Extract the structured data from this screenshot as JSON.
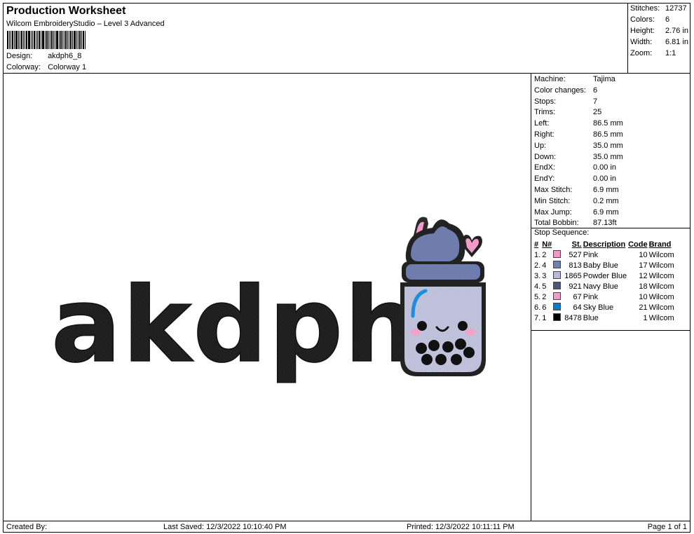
{
  "header": {
    "title": "Production Worksheet",
    "subtitle": "Wilcom EmbroideryStudio – Level 3 Advanced",
    "design_label": "Design:",
    "design_value": "akdph6_8",
    "colorway_label": "Colorway:",
    "colorway_value": "Colorway 1"
  },
  "summary": [
    {
      "label": "Stitches:",
      "value": "12737"
    },
    {
      "label": "Colors:",
      "value": "6"
    },
    {
      "label": "Height:",
      "value": "2.76 in"
    },
    {
      "label": "Width:",
      "value": "6.81 in"
    },
    {
      "label": "Zoom:",
      "value": "1:1"
    }
  ],
  "machine_info": [
    {
      "label": "Machine:",
      "value": "Tajima"
    },
    {
      "label": "Color changes:",
      "value": "6"
    },
    {
      "label": "Stops:",
      "value": "7"
    },
    {
      "label": "Trims:",
      "value": "25"
    },
    {
      "label": "Left:",
      "value": "86.5 mm"
    },
    {
      "label": "Right:",
      "value": "86.5 mm"
    },
    {
      "label": "Up:",
      "value": "35.0 mm"
    },
    {
      "label": "Down:",
      "value": "35.0 mm"
    },
    {
      "label": "EndX:",
      "value": "0.00 in"
    },
    {
      "label": "EndY:",
      "value": "0.00 in"
    },
    {
      "label": "Max Stitch:",
      "value": "6.9 mm"
    },
    {
      "label": "Min Stitch:",
      "value": "0.2 mm"
    },
    {
      "label": "Max Jump:",
      "value": "6.9 mm"
    },
    {
      "label": "Total Bobbin:",
      "value": "87.13ft"
    }
  ],
  "stop_sequence": {
    "title": "Stop Sequence:",
    "headers": {
      "num": "#",
      "n": "N#",
      "st": "St.",
      "desc": "Description",
      "code": "Code",
      "brand": "Brand"
    },
    "rows": [
      {
        "num": "1.",
        "n": "2",
        "color": "#f39bc8",
        "st": "527",
        "desc": "Pink",
        "code": "10",
        "brand": "Wilcom"
      },
      {
        "num": "2.",
        "n": "4",
        "color": "#6f7fb0",
        "st": "813",
        "desc": "Baby Blue",
        "code": "17",
        "brand": "Wilcom"
      },
      {
        "num": "3.",
        "n": "3",
        "color": "#b8b9d9",
        "st": "1865",
        "desc": "Powder Blue",
        "code": "12",
        "brand": "Wilcom"
      },
      {
        "num": "4.",
        "n": "5",
        "color": "#4d5578",
        "st": "921",
        "desc": "Navy Blue",
        "code": "18",
        "brand": "Wilcom"
      },
      {
        "num": "5.",
        "n": "2",
        "color": "#f39bc8",
        "st": "67",
        "desc": "Pink",
        "code": "10",
        "brand": "Wilcom"
      },
      {
        "num": "6.",
        "n": "6",
        "color": "#0a7ac8",
        "st": "64",
        "desc": "Sky Blue",
        "code": "21",
        "brand": "Wilcom"
      },
      {
        "num": "7.",
        "n": "1",
        "color": "#000000",
        "st": "8478",
        "desc": "Blue",
        "code": "1",
        "brand": "Wilcom"
      }
    ]
  },
  "design": {
    "text": "akdph",
    "thread_color": "#1c1c1c"
  },
  "footer": {
    "created_by": "Created By:",
    "last_saved": "Last Saved: 12/3/2022 10:10:40 PM",
    "printed": "Printed: 12/3/2022 10:11:11 PM",
    "page": "Page 1 of 1"
  }
}
